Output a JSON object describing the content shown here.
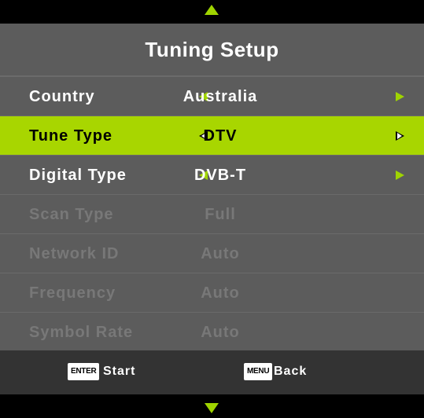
{
  "menu": {
    "title": "Tuning Setup",
    "rows": [
      {
        "label": "Country",
        "value": "Australia"
      },
      {
        "label": "Tune Type",
        "value": "DTV"
      },
      {
        "label": "Digital Type",
        "value": "DVB-T"
      },
      {
        "label": "Scan Type",
        "value": "Full"
      },
      {
        "label": "Network ID",
        "value": "Auto"
      },
      {
        "label": "Frequency",
        "value": "Auto"
      },
      {
        "label": "Symbol Rate",
        "value": "Auto"
      }
    ]
  },
  "footer": {
    "enter_key": "ENTER",
    "enter_label": "Start",
    "menu_key": "MENU",
    "menu_label": "Back"
  },
  "colors": {
    "accent": "#a8d600",
    "panel_bg": "#5c5c5c",
    "footer_bg": "#333333",
    "disabled_text": "#787878"
  },
  "icons": {
    "scroll_up": "triangle-up-icon",
    "scroll_down": "triangle-down-icon",
    "prev": "triangle-left-icon",
    "next": "triangle-right-icon"
  }
}
